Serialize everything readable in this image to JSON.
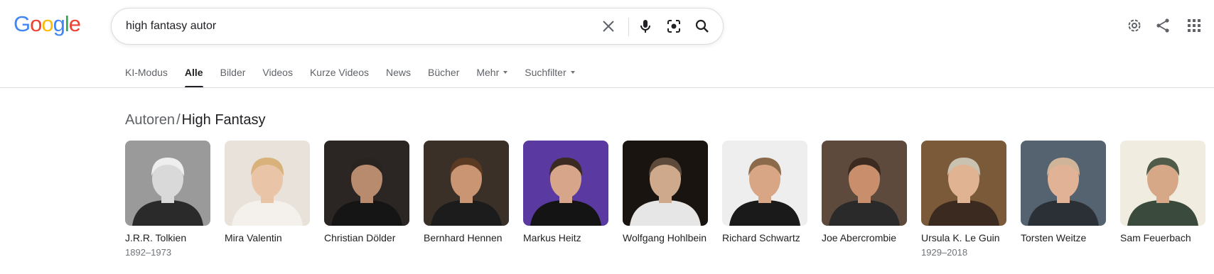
{
  "logo": {
    "letters": [
      "G",
      "o",
      "o",
      "g",
      "l",
      "e"
    ],
    "colors": [
      "#4285F4",
      "#EA4335",
      "#FBBC05",
      "#4285F4",
      "#34A853",
      "#EA4335"
    ]
  },
  "search": {
    "query": "high fantasy autor",
    "icons": [
      "close-icon",
      "microphone-icon",
      "lens-icon",
      "search-icon"
    ]
  },
  "header_icons": [
    "settings-icon",
    "share-icon",
    "apps-icon"
  ],
  "tabs": [
    {
      "label": "KI-Modus"
    },
    {
      "label": "Alle",
      "active": true
    },
    {
      "label": "Bilder"
    },
    {
      "label": "Videos"
    },
    {
      "label": "Kurze Videos"
    },
    {
      "label": "News"
    },
    {
      "label": "Bücher"
    },
    {
      "label": "Mehr",
      "dropdown": true
    },
    {
      "label": "Suchfilter",
      "dropdown": true
    }
  ],
  "section": {
    "parent": "Autoren",
    "separator": "/",
    "current": "High Fantasy"
  },
  "authors": [
    {
      "name": "J.R.R. Tolkien",
      "years": "1892–1973",
      "bg": "#9a9a9a",
      "skin": "#d9d9d9",
      "hair": "#eeeeee",
      "cloth": "#2a2a2a"
    },
    {
      "name": "Mira Valentin",
      "years": "",
      "bg": "#e8e2da",
      "skin": "#e9c4a6",
      "hair": "#d8b27a",
      "cloth": "#f4f1ec"
    },
    {
      "name": "Christian Dölder",
      "years": "",
      "bg": "#2b2623",
      "skin": "#b98b6e",
      "hair": "#2a2420",
      "cloth": "#151515"
    },
    {
      "name": "Bernhard Hennen",
      "years": "",
      "bg": "#3a3028",
      "skin": "#c99572",
      "hair": "#5a3a22",
      "cloth": "#1c1c1c"
    },
    {
      "name": "Markus Heitz",
      "years": "",
      "bg": "#5a3aa0",
      "skin": "#d6a58a",
      "hair": "#3a2a22",
      "cloth": "#141414"
    },
    {
      "name": "Wolfgang Hohlbein",
      "years": "",
      "bg": "#1a1410",
      "skin": "#cfa98c",
      "hair": "#5e4a3a",
      "cloth": "#e6e6e6"
    },
    {
      "name": "Richard Schwartz",
      "years": "",
      "bg": "#eeeeee",
      "skin": "#d8a684",
      "hair": "#8a6a4a",
      "cloth": "#1a1a1a"
    },
    {
      "name": "Joe Abercrombie",
      "years": "",
      "bg": "#5e4a3c",
      "skin": "#c98f6c",
      "hair": "#3a2a20",
      "cloth": "#2a2a2a"
    },
    {
      "name": "Ursula K. Le Guin",
      "years": "1929–2018",
      "bg": "#7a5a38",
      "skin": "#e0b493",
      "hair": "#c9c2b0",
      "cloth": "#3a2a20"
    },
    {
      "name": "Torsten Weitze",
      "years": "",
      "bg": "#556270",
      "skin": "#e1b296",
      "hair": "#cfb49a",
      "cloth": "#2b2f36"
    },
    {
      "name": "Sam Feuerbach",
      "years": "",
      "bg": "#f1ece0",
      "skin": "#d7a888",
      "hair": "#4f5a48",
      "cloth": "#3a4a3c"
    }
  ]
}
